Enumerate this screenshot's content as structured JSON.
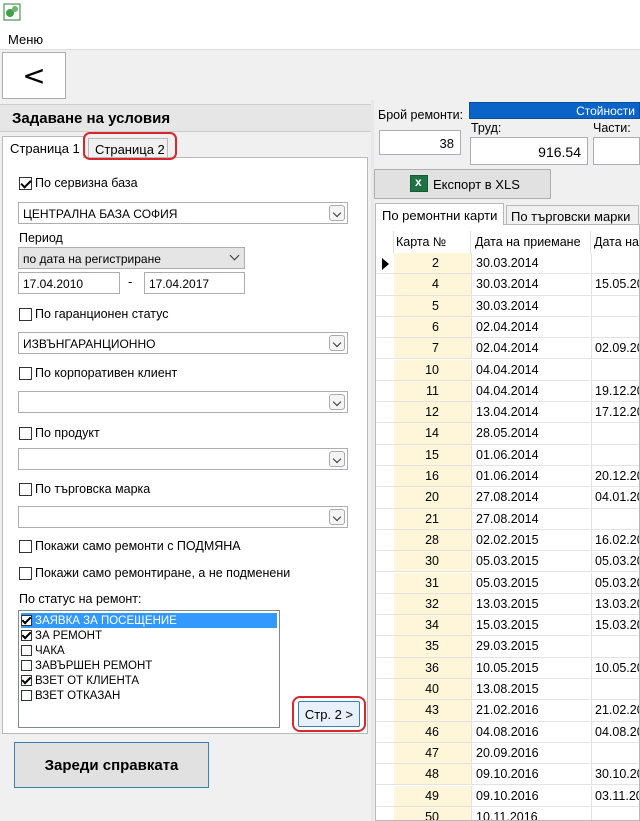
{
  "menu": {
    "label": "Меню"
  },
  "nav": {
    "back_label": "<"
  },
  "left_panel": {
    "title": "Задаване на условия",
    "tabs": [
      "Страница 1",
      "Страница 2"
    ],
    "service_base": {
      "checkbox_label": "По сервизна база",
      "checked": true,
      "value": "ЦЕНТРАЛНА БАЗА СОФИЯ"
    },
    "period": {
      "label": "Период",
      "type_value": "по дата на регистриране",
      "from": "17.04.2010",
      "separator": "-",
      "to": "17.04.2017"
    },
    "warranty": {
      "checkbox_label": "По гаранционен статус",
      "checked": false,
      "value": "ИЗВЪНГАРАНЦИОННО"
    },
    "corporate": {
      "checkbox_label": "По корпоративен клиент",
      "checked": false,
      "value": ""
    },
    "product": {
      "checkbox_label": "По продукт",
      "checked": false,
      "value": ""
    },
    "brand": {
      "checkbox_label": "По търговска марка",
      "checked": false,
      "value": ""
    },
    "only_replace": {
      "checkbox_label": "Покажи само ремонти с ПОДМЯНА",
      "checked": false
    },
    "only_repair": {
      "checkbox_label": "Покажи само ремонтиране, а не подменени",
      "checked": false
    },
    "status": {
      "label": "По статус на ремонт:",
      "items": [
        {
          "label": "ЗАЯВКА ЗА ПОСЕЩЕНИЕ",
          "checked": true,
          "selected": true
        },
        {
          "label": "ЗА РЕМОНТ",
          "checked": true,
          "selected": false
        },
        {
          "label": "ЧАКА",
          "checked": false,
          "selected": false
        },
        {
          "label": "ЗАВЪРШЕН РЕМОНТ",
          "checked": false,
          "selected": false
        },
        {
          "label": "ВЗЕТ ОТ КЛИЕНТА",
          "checked": true,
          "selected": false
        },
        {
          "label": "ВЗЕТ ОТКАЗАН",
          "checked": false,
          "selected": false
        }
      ]
    },
    "page2_button": "Стр. 2 >",
    "load_button": "Зареди справката"
  },
  "right_panel": {
    "count_label": "Брой ремонти:",
    "count_value": "38",
    "costs_header": "Стойности",
    "labor_label": "Труд:",
    "labor_value": "916.54",
    "parts_label": "Части:",
    "parts_value": "",
    "export_button": "Експорт в XLS",
    "tabs": [
      "По ремонтни карти",
      "По търговски марки"
    ],
    "grid": {
      "columns": [
        "Карта №",
        "Дата на приемане",
        "Дата на"
      ],
      "rows": [
        [
          "2",
          "30.03.2014",
          ""
        ],
        [
          "4",
          "30.03.2014",
          "15.05.20"
        ],
        [
          "5",
          "30.03.2014",
          ""
        ],
        [
          "6",
          "02.04.2014",
          ""
        ],
        [
          "7",
          "02.04.2014",
          "02.09.20"
        ],
        [
          "10",
          "04.04.2014",
          ""
        ],
        [
          "11",
          "04.04.2014",
          "19.12.20"
        ],
        [
          "12",
          "13.04.2014",
          "17.12.20"
        ],
        [
          "14",
          "28.05.2014",
          ""
        ],
        [
          "15",
          "01.06.2014",
          ""
        ],
        [
          "16",
          "01.06.2014",
          "20.12.20"
        ],
        [
          "20",
          "27.08.2014",
          "04.01.20"
        ],
        [
          "21",
          "27.08.2014",
          ""
        ],
        [
          "28",
          "02.02.2015",
          "16.02.20"
        ],
        [
          "30",
          "05.03.2015",
          "05.03.20"
        ],
        [
          "31",
          "05.03.2015",
          "05.03.20"
        ],
        [
          "32",
          "13.03.2015",
          "13.03.20"
        ],
        [
          "34",
          "15.03.2015",
          "15.03.20"
        ],
        [
          "35",
          "29.03.2015",
          ""
        ],
        [
          "36",
          "10.05.2015",
          "10.05.20"
        ],
        [
          "40",
          "13.08.2015",
          ""
        ],
        [
          "43",
          "21.02.2016",
          "21.02.20"
        ],
        [
          "46",
          "04.08.2016",
          "04.08.20"
        ],
        [
          "47",
          "20.09.2016",
          ""
        ],
        [
          "48",
          "09.10.2016",
          "30.10.20"
        ],
        [
          "49",
          "09.10.2016",
          "03.11.20"
        ],
        [
          "50",
          "10.11.2016",
          ""
        ]
      ]
    }
  },
  "colors": {
    "highlight": "#d9262c",
    "selection": "#3399ff",
    "header_blue": "#0a64c8",
    "key_column": "#fff6d9"
  }
}
